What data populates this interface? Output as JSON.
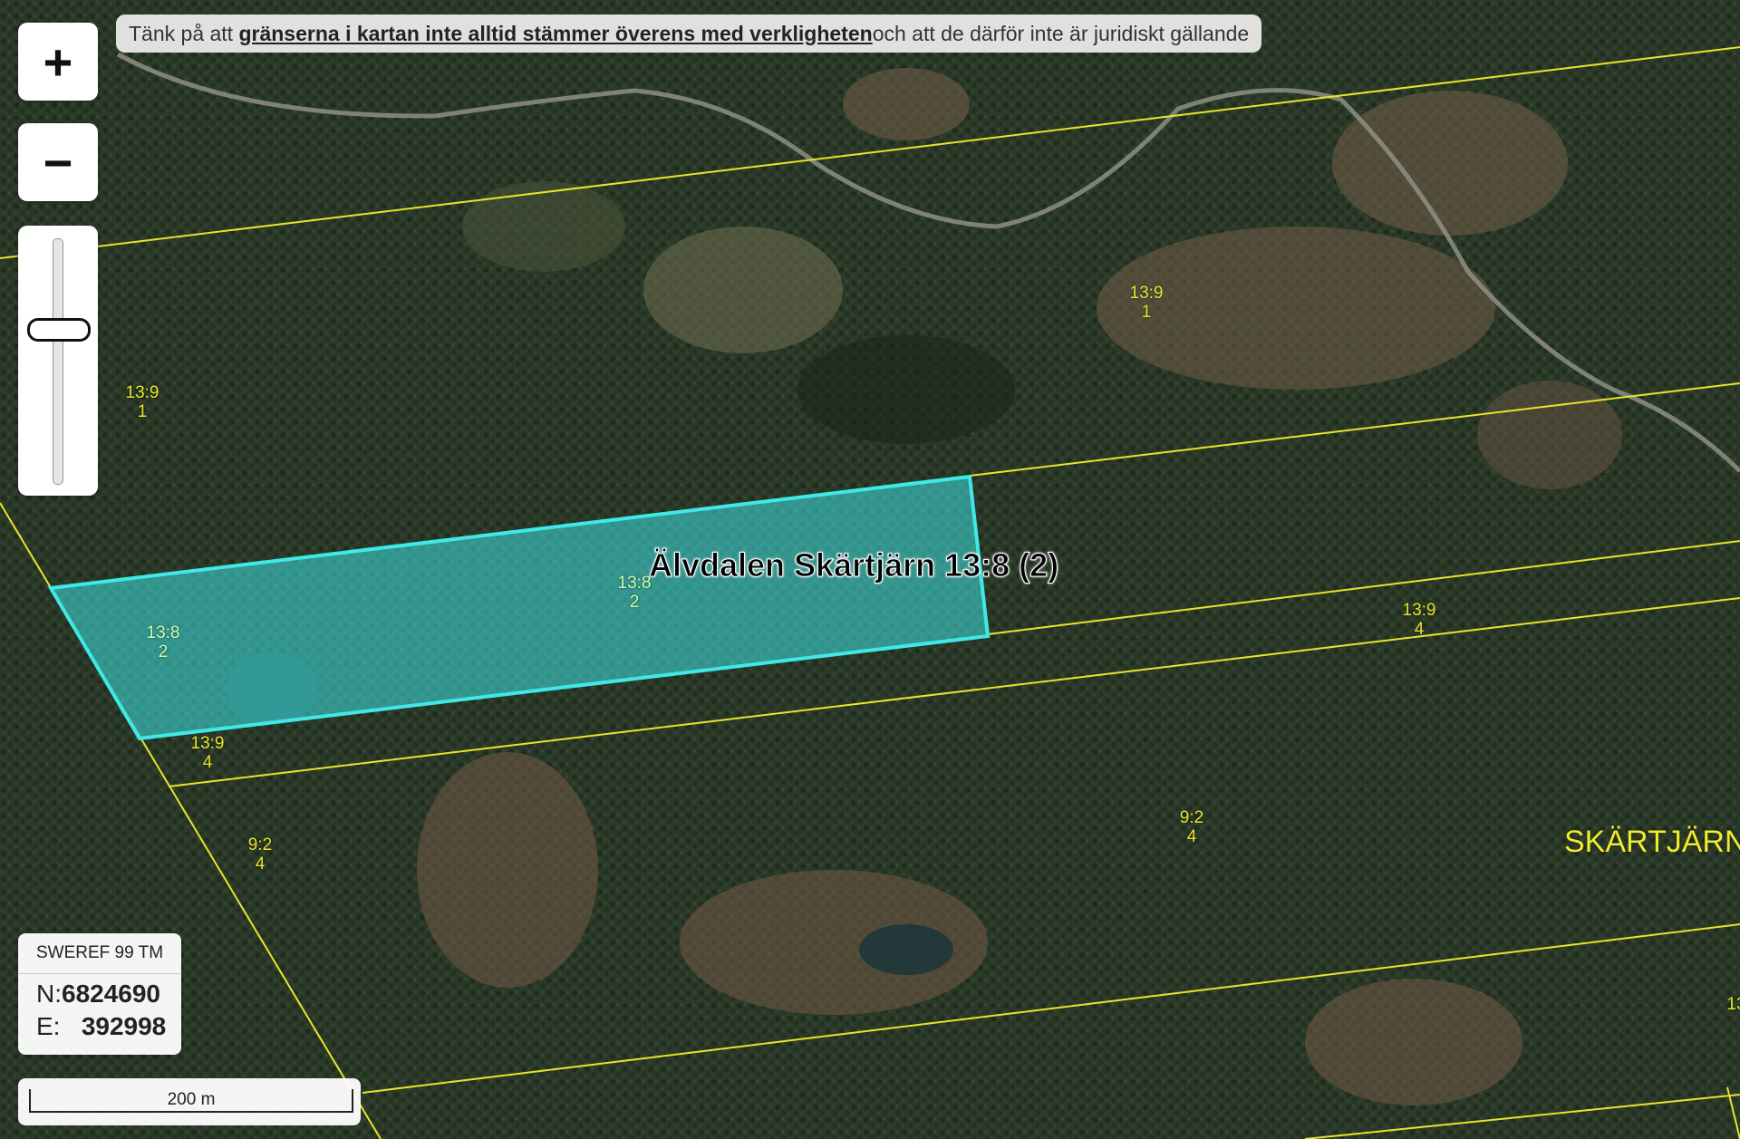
{
  "banner": {
    "prefix": "Tänk på att ",
    "emphasis": "gränserna i kartan inte alltid stämmer överens med verkligheten",
    "suffix": " och att de därför inte är juridiskt gällande"
  },
  "zoom": {
    "in_label": "+",
    "out_label": "−",
    "level_fraction": 0.35
  },
  "coords": {
    "system": "SWEREF 99 TM",
    "n_label": "N:",
    "n_value": "6824690",
    "e_label": "E:",
    "e_value": "392998"
  },
  "scale": {
    "label": "200 m"
  },
  "selected_parcel": {
    "title": "Älvdalen Skärtjärn 13:8 (2)"
  },
  "area_name": "SKÄRTJÄRN",
  "parcel_labels": [
    {
      "id": "13:9",
      "sub": "1"
    },
    {
      "id": "13:9",
      "sub": "1"
    },
    {
      "id": "13:8",
      "sub": "2"
    },
    {
      "id": "13:8",
      "sub": "2"
    },
    {
      "id": "13:9",
      "sub": "4"
    },
    {
      "id": "13:9",
      "sub": "4"
    },
    {
      "id": "9:2",
      "sub": "4"
    },
    {
      "id": "9:2",
      "sub": "4"
    },
    {
      "id": "13",
      "sub": ""
    }
  ],
  "colors": {
    "boundary": "#e8e42c",
    "selection": "#40e0e0",
    "forest": "#2e3d2b"
  }
}
